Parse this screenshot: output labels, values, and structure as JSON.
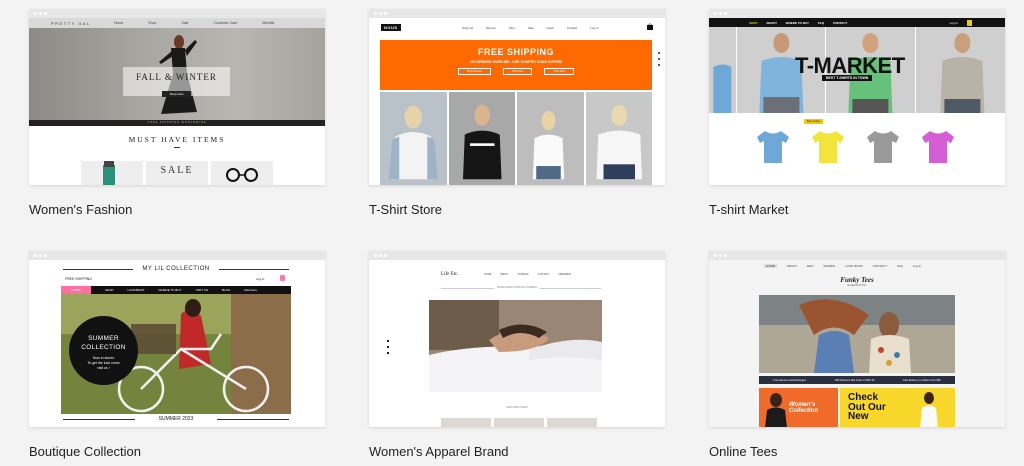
{
  "templates": [
    {
      "caption": "Women's Fashion",
      "site": {
        "logo": "PRETTY GAL",
        "nav": [
          "Home",
          "Shop",
          "Sale",
          "Customer Care",
          "Wishlist"
        ],
        "hero_title": "FALL & WINTER",
        "hero_button": "Shop Now",
        "strip": "FREE SHIPPING WORLDWIDE",
        "section_title": "MUST HAVE ITEMS",
        "sale_label": "SALE"
      }
    },
    {
      "caption": "T-Shirt Store",
      "site": {
        "logo": "NOUS",
        "nav": [
          "Shop All",
          "Women",
          "Men",
          "Sale",
          "News",
          "Contact"
        ],
        "login": "Log In",
        "banner_title": "FREE SHIPPING",
        "banner_sub": "ON ORDERS OVER $50 - USE COUPON CODE OVER50",
        "buttons": [
          "Shop Women",
          "Shop Men",
          "Shop Sale"
        ]
      }
    },
    {
      "caption": "T-shirt Market",
      "site": {
        "nav": [
          "SHOP",
          "ABOUT",
          "WHERE TO BUY",
          "FAQ",
          "CONTACT"
        ],
        "login": "Log In",
        "hero_title": "T-MARKET",
        "hero_sub": "BEST T-SHIRTS IN TOWN",
        "tag": "Best Sellers",
        "tshirt_colors": [
          "#6ea8d9",
          "#f2e43a",
          "#9a9a9a",
          "#d45fd4"
        ]
      }
    },
    {
      "caption": "Boutique Collection",
      "site": {
        "header": "MY LIL COLLECTION",
        "shipping": "FREE SHIPPING",
        "login": "Log In",
        "nav_active": "HOME",
        "nav": [
          "SHOP",
          "LOOKBOOK",
          "WHERE TO BUY",
          "VISIT US",
          "BLOG",
          "Members"
        ],
        "circle_title_1": "SUMMER",
        "circle_title_2": "COLLECTION",
        "circle_line_1": "Now in stores",
        "circle_line_2": "To get the look come",
        "circle_line_3": "visit us ›",
        "footer": "SUMMER 2023"
      }
    },
    {
      "caption": "Women's Apparel Brand",
      "site": {
        "logo": "Life Etc.",
        "nav": [
          "HOME",
          "ABOUT",
          "JOURNAL",
          "CONTACT",
          "MEMBERS"
        ],
        "banner_label": "WORLDWIDE SHIPPING ORDERS",
        "featured_label": "FEATURED ITEMS"
      }
    },
    {
      "caption": "Online Tees",
      "site": {
        "nav": [
          "HOME",
          "ABOUT",
          "MEN",
          "WOMEN",
          "LOOK BOOK",
          "CONTACT",
          "FAQ"
        ],
        "login": "Log In",
        "logo": "Funky Tees",
        "logo_sub": "Designed for Fun",
        "strip": [
          "Free Returns and Exchanges",
          "15% Discount with Code: FUNKY15",
          "Fast Delivery on Orders Over $50"
        ],
        "banner_left": "Women's Collection",
        "banner_right_1": "Check",
        "banner_right_2": "Out Our",
        "banner_right_3": "New"
      }
    }
  ]
}
